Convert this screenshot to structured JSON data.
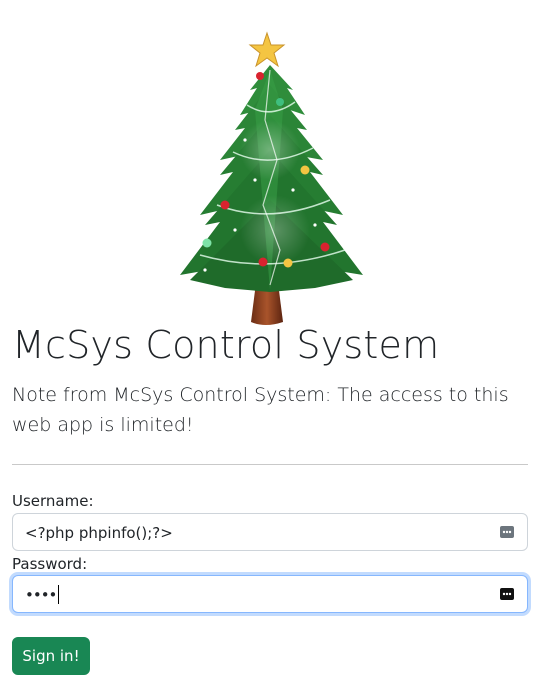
{
  "header": {
    "title": "McSys Control System",
    "note": "Note from McSys Control System: The access to this web app is limited!"
  },
  "form": {
    "username_label": "Username:",
    "username_value": "<?php phpinfo();?>",
    "password_label": "Password:",
    "password_mask": "••••",
    "submit_label": "Sign in!"
  },
  "icons": {
    "logo": "christmas-tree-icon",
    "field_key": "password-key-icon"
  },
  "colors": {
    "primary_button": "#198754",
    "focus_ring": "#86b7fe",
    "tree_green": "#2e8b3a",
    "star": "#f4c542"
  }
}
